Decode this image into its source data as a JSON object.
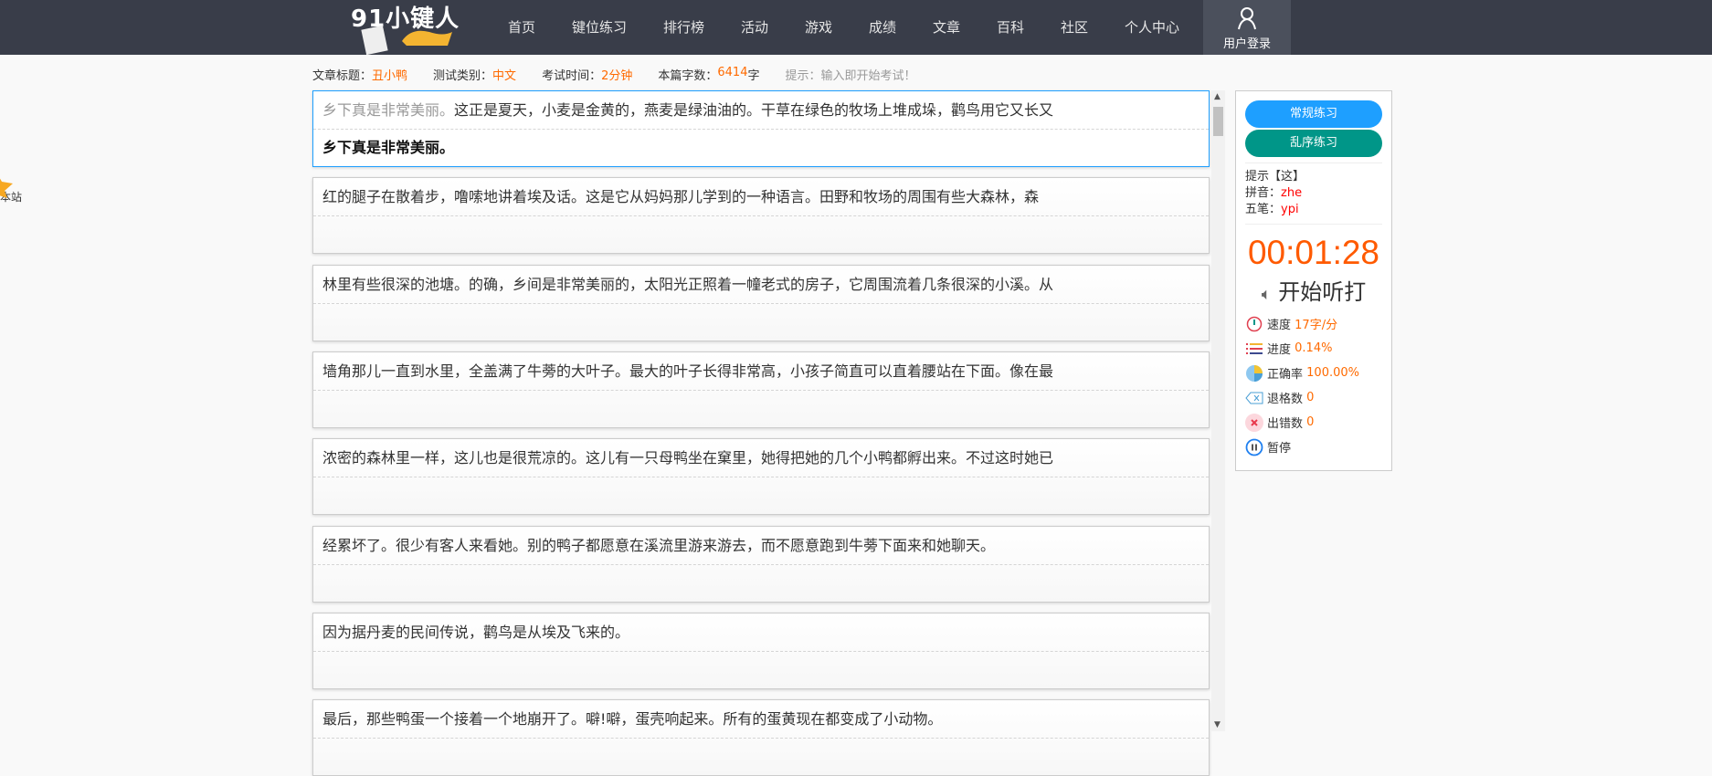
{
  "nav": {
    "logo": "91小键人",
    "items": [
      "首页",
      "键位练习",
      "排行榜",
      "活动",
      "游戏",
      "成绩",
      "文章",
      "百科",
      "社区",
      "个人中心"
    ],
    "login": "用户登录"
  },
  "info": {
    "title_label": "文章标题：",
    "title": "丑小鸭",
    "type_label": "测试类别：",
    "type": "中文",
    "time_label": "考试时间：",
    "time": "2分钟",
    "count_label": "本篇字数：",
    "count": "6414",
    "count_unit": "字",
    "hint": "提示：输入即开始考试！"
  },
  "lines": [
    {
      "typed": "乡下真是非常美丽。",
      "rest": "这正是夏天，小麦是金黄的，燕麦是绿油油的。干草在绿色的牧场上堆成垛，鹳鸟用它又长又",
      "input": "乡下真是非常美丽。"
    },
    {
      "text": "红的腿子在散着步，噜嗦地讲着埃及话。这是它从妈妈那儿学到的一种语言。田野和牧场的周围有些大森林，森"
    },
    {
      "text": "林里有些很深的池塘。的确，乡间是非常美丽的，太阳光正照着一幢老式的房子，它周围流着几条很深的小溪。从"
    },
    {
      "text": "墙角那儿一直到水里，全盖满了牛蒡的大叶子。最大的叶子长得非常高，小孩子简直可以直着腰站在下面。像在最"
    },
    {
      "text": "浓密的森林里一样，这儿也是很荒凉的。这儿有一只母鸭坐在窠里，她得把她的几个小鸭都孵出来。不过这时她已"
    },
    {
      "text": "经累坏了。很少有客人来看她。别的鸭子都愿意在溪流里游来游去，而不愿意跑到牛蒡下面来和她聊天。"
    },
    {
      "text": "因为据丹麦的民间传说，鹳鸟是从埃及飞来的。"
    },
    {
      "text": "最后，那些鸭蛋一个接着一个地崩开了。噼!噼，蛋壳响起来。所有的蛋黄现在都变成了小动物。"
    }
  ],
  "panel": {
    "btn_normal": "常规练习",
    "btn_random": "乱序练习",
    "hint": "提示【这】",
    "pinyin_label": "拼音：",
    "pinyin": "zhe",
    "wubi_label": "五笔：",
    "wubi": "ypi",
    "timer": "00:01:28",
    "listen": "开始听打",
    "stats": [
      {
        "label": "速度",
        "value": "17字/分"
      },
      {
        "label": "进度",
        "value": "0.14%"
      },
      {
        "label": "正确率",
        "value": "100.00%"
      },
      {
        "label": "退格数",
        "value": "0"
      },
      {
        "label": "出错数",
        "value": "0"
      }
    ],
    "pause": "暂停"
  },
  "side": {
    "label": "本站"
  },
  "colors": {
    "accent": "#ff6a00",
    "blue": "#1e9fff",
    "teal": "#009688",
    "nav": "#393d49"
  }
}
